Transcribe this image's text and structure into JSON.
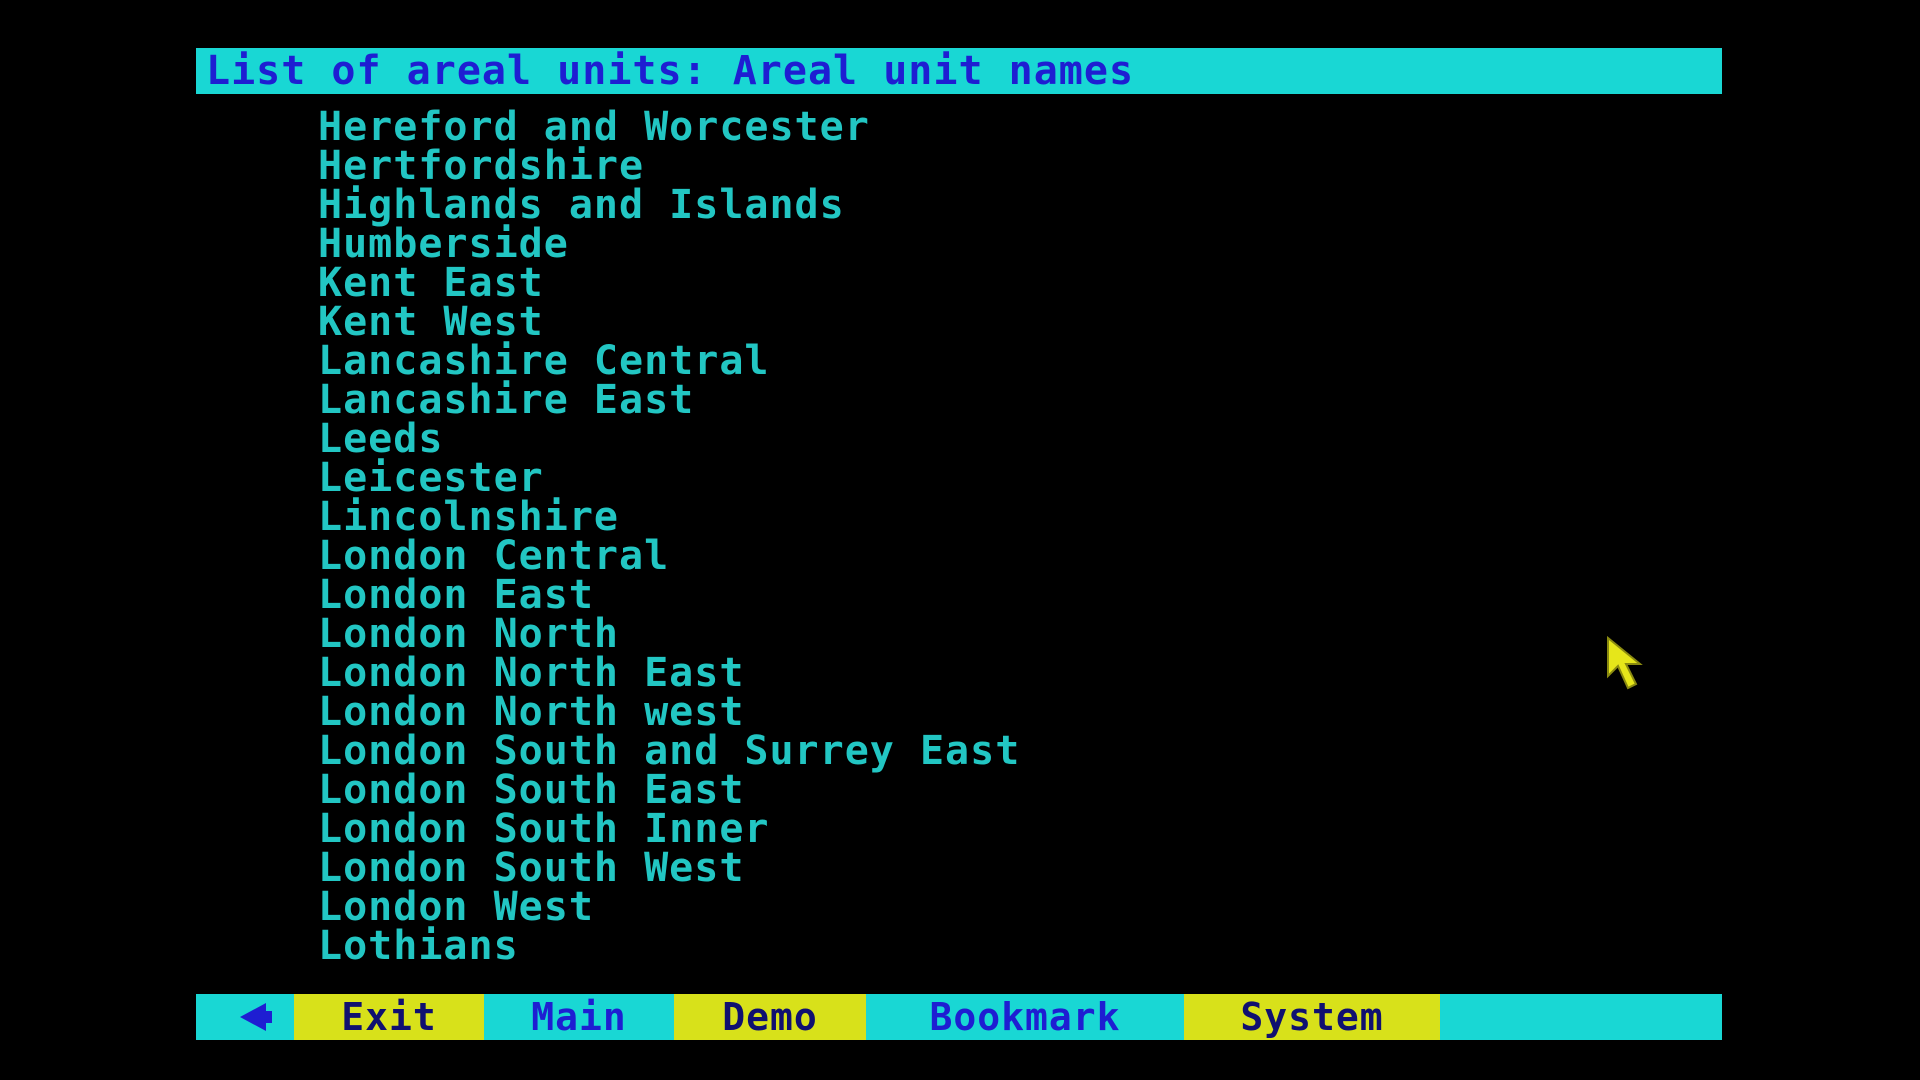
{
  "title": "List of areal units: Areal unit names",
  "units": [
    "Hereford and Worcester",
    "Hertfordshire",
    "Highlands and Islands",
    "Humberside",
    "Kent East",
    "Kent West",
    "Lancashire Central",
    "Lancashire East",
    "Leeds",
    "Leicester",
    "Lincolnshire",
    "London Central",
    "London East",
    "London North",
    "London North East",
    "London North west",
    "London South and Surrey East",
    "London South East",
    "London South Inner",
    "London South West",
    "London West",
    "Lothians"
  ],
  "menu": {
    "back_icon": "left-arrow-icon",
    "exit": "Exit",
    "main": "Main",
    "demo": "Demo",
    "bookmark": "Bookmark",
    "system": "System"
  },
  "colors": {
    "background": "#000000",
    "bar": "#19d7d4",
    "bar_text": "#1e1ed2",
    "list_text": "#22c6c3",
    "highlight_button": "#d8e11a",
    "cursor": "#e6e61a"
  }
}
